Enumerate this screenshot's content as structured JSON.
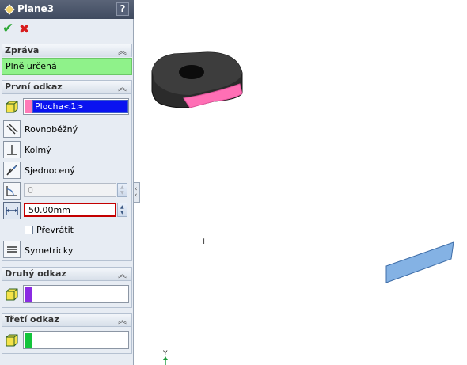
{
  "title": "Plane3",
  "help_label": "?",
  "groups": {
    "message": {
      "title": "Zpráva",
      "text": "Plně určená"
    },
    "first_ref": {
      "title": "První odkaz",
      "selection": "Plocha<1>",
      "options": {
        "parallel": "Rovnoběžný",
        "perpendicular": "Kolmý",
        "coincident": "Sjednocený"
      },
      "angle_value": "0",
      "distance_value": "50.00mm",
      "flip_label": "Převrátit",
      "symmetric_label": "Symetricky"
    },
    "second_ref": {
      "title": "Druhý odkaz"
    },
    "third_ref": {
      "title": "Třetí odkaz"
    }
  },
  "colors": {
    "first_swatch": "#ff7ab8",
    "second_swatch": "#8a2be2",
    "third_swatch": "#13c43b",
    "message_bg": "#8ff28a",
    "selection_bg": "#0a13f0"
  },
  "icons": {
    "ok": "check-icon",
    "cancel": "x-icon",
    "collapse": "double-chevron-up-icon"
  },
  "viewport": {
    "axis_label": "Y"
  }
}
